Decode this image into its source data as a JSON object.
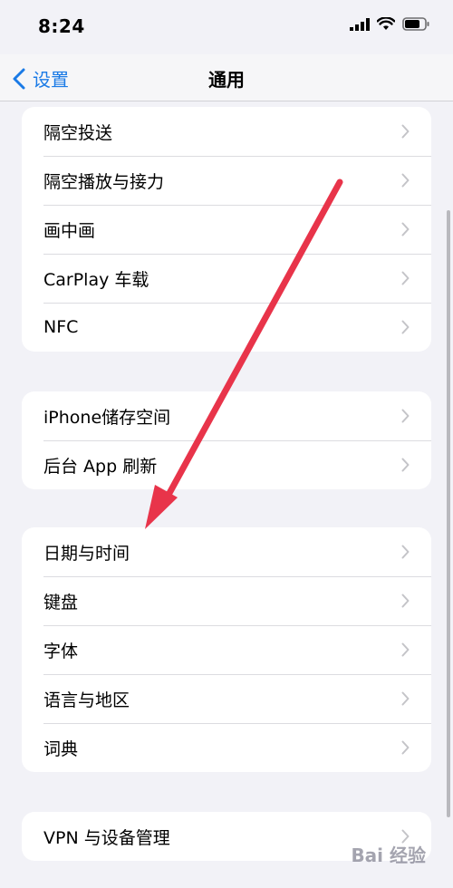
{
  "status_bar": {
    "time": "8:24"
  },
  "nav": {
    "back_label": "设置",
    "title": "通用"
  },
  "groups": [
    {
      "items": [
        {
          "label": "隔空投送"
        },
        {
          "label": "隔空播放与接力"
        },
        {
          "label": "画中画"
        },
        {
          "label": "CarPlay 车载"
        },
        {
          "label": "NFC"
        }
      ]
    },
    {
      "items": [
        {
          "label": "iPhone储存空间"
        },
        {
          "label": "后台 App 刷新"
        }
      ]
    },
    {
      "items": [
        {
          "label": "日期与时间"
        },
        {
          "label": "键盘"
        },
        {
          "label": "字体"
        },
        {
          "label": "语言与地区"
        },
        {
          "label": "词典"
        }
      ]
    },
    {
      "items": [
        {
          "label": "VPN 与设备管理"
        }
      ]
    }
  ],
  "watermark": "Bai 经验",
  "colors": {
    "accent": "#1a7ae6",
    "annotation_arrow": "#e8344a",
    "background": "#f2f2f7"
  }
}
